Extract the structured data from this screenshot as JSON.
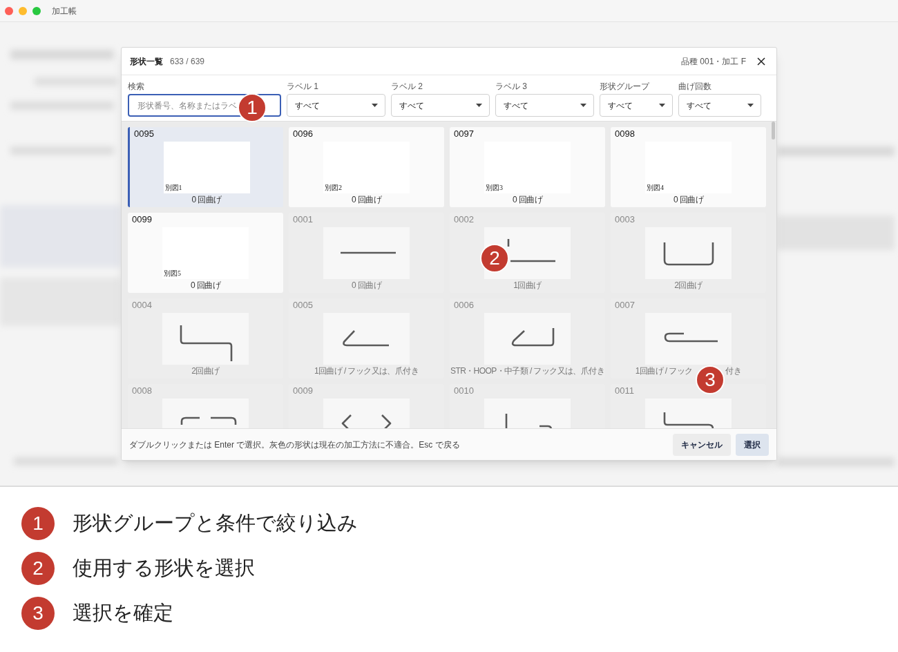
{
  "window": {
    "title": "加工帳"
  },
  "dialog": {
    "title": "形状一覧",
    "count": "633 / 639",
    "context": "品種 001・加工 F"
  },
  "filters": [
    {
      "kind": "search",
      "label": "検索",
      "placeholder": "形状番号、名称またはラベ",
      "focused": true
    },
    {
      "kind": "select",
      "label": "ラベル 1",
      "value": "すべて"
    },
    {
      "kind": "select",
      "label": "ラベル 2",
      "value": "すべて"
    },
    {
      "kind": "select",
      "label": "ラベル 3",
      "value": "すべて"
    },
    {
      "kind": "select",
      "label": "形状グループ",
      "value": "すべて"
    },
    {
      "kind": "select",
      "label": "曲げ回数",
      "value": "すべて"
    }
  ],
  "cards": [
    {
      "kind": "custom",
      "number": "0095",
      "label": "別図1",
      "caption": "0 回曲げ",
      "compatible": true,
      "selected": true
    },
    {
      "kind": "custom",
      "number": "0096",
      "label": "別図2",
      "caption": "0 回曲げ",
      "compatible": true,
      "selected": false
    },
    {
      "kind": "custom",
      "number": "0097",
      "label": "別図3",
      "caption": "0 回曲げ",
      "compatible": true,
      "selected": false
    },
    {
      "kind": "custom",
      "number": "0098",
      "label": "別図4",
      "caption": "0 回曲げ",
      "compatible": true,
      "selected": false
    },
    {
      "kind": "custom",
      "number": "0099",
      "label": "別図5",
      "caption": "0 回曲げ",
      "compatible": true,
      "selected": false
    },
    {
      "kind": "standard",
      "number": "0001",
      "caption": "0 回曲げ",
      "compatible": false,
      "selected": false
    },
    {
      "kind": "standard",
      "number": "0002",
      "caption": "1回曲げ",
      "compatible": false,
      "selected": false
    },
    {
      "kind": "standard",
      "number": "0003",
      "caption": "2回曲げ",
      "compatible": false,
      "selected": false
    },
    {
      "kind": "standard",
      "number": "0004",
      "caption": "2回曲げ",
      "compatible": false,
      "selected": false
    },
    {
      "kind": "standard",
      "number": "0005",
      "caption": "1回曲げ / フック又は、爪付き",
      "compatible": false,
      "selected": false
    },
    {
      "kind": "standard",
      "number": "0006",
      "caption": "STR・HOOP・中子類 / フック又は、爪付き",
      "compatible": false,
      "selected": false
    },
    {
      "kind": "standard",
      "number": "0007",
      "caption": "1回曲げ / フック",
      "caption_end": "付き",
      "compatible": false,
      "selected": false
    },
    {
      "kind": "standard",
      "number": "0008",
      "compatible": false,
      "selected": false
    },
    {
      "kind": "standard",
      "number": "0009",
      "compatible": false,
      "selected": false
    },
    {
      "kind": "standard",
      "number": "0010",
      "compatible": false,
      "selected": false
    },
    {
      "kind": "standard",
      "number": "0011",
      "compatible": false,
      "selected": false
    }
  ],
  "footer": {
    "hint": "ダブルクリックまたは Enter で選択。灰色の形状は現在の加工方法に不適合。Esc で戻る",
    "buttons": [
      {
        "label": "キャンセル",
        "primary": false
      },
      {
        "label": "選択",
        "primary": true
      }
    ]
  },
  "callouts": [
    {
      "number": "1"
    },
    {
      "number": "2"
    },
    {
      "number": "3"
    }
  ],
  "legend": [
    {
      "number": "1",
      "text": "形状グループと条件で絞り込み"
    },
    {
      "number": "2",
      "text": "使用する形状を選択"
    },
    {
      "number": "3",
      "text": "選択を確定"
    }
  ]
}
